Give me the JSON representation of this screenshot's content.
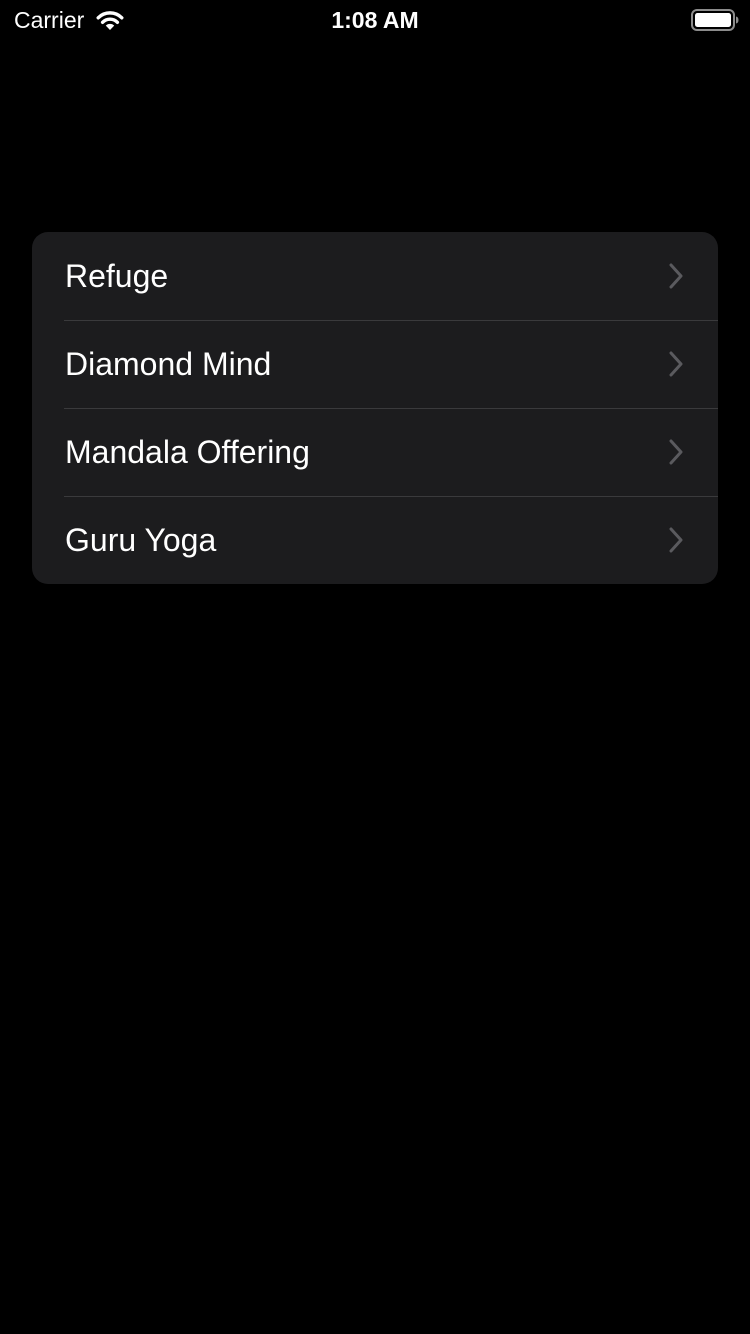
{
  "status_bar": {
    "carrier": "Carrier",
    "time": "1:08 AM",
    "wifi_icon": "wifi-icon",
    "battery_icon": "battery-full-icon"
  },
  "menu": {
    "items": [
      {
        "label": "Refuge",
        "icon": "chevron-right-icon"
      },
      {
        "label": "Diamond Mind",
        "icon": "chevron-right-icon"
      },
      {
        "label": "Mandala Offering",
        "icon": "chevron-right-icon"
      },
      {
        "label": "Guru Yoga",
        "icon": "chevron-right-icon"
      }
    ]
  },
  "colors": {
    "background": "#000000",
    "card": "#1c1c1e",
    "separator": "#3a3a3c",
    "text": "#ffffff",
    "chevron": "#5a5a5e"
  }
}
